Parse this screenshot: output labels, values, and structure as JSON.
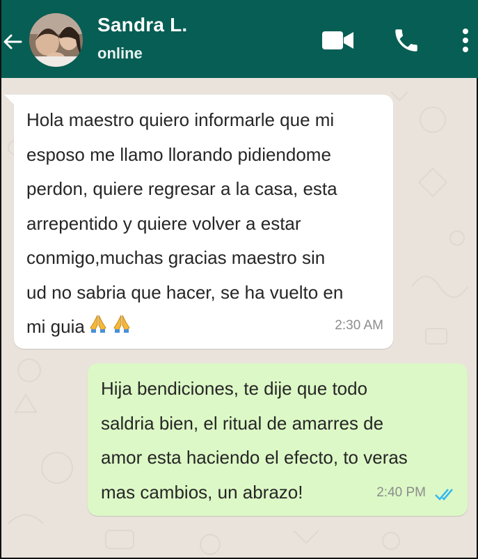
{
  "header": {
    "contact_name": "Sandra L.",
    "contact_status": "online",
    "icons": [
      "back-arrow-icon",
      "video-call-icon",
      "phone-icon",
      "more-options-icon"
    ]
  },
  "colors": {
    "header_bg": "#075e54",
    "chat_bg": "#e9e3dc",
    "incoming_bubble": "#ffffff",
    "outgoing_bubble": "#dcf8c6",
    "read_ticks": "#34b7f1"
  },
  "messages": [
    {
      "direction": "incoming",
      "text": "Hola maestro quiero informarle que mi\nesposo me llamo llorando pidiendome\nperdon, quiere regresar a la casa, esta\narrepentido y quiere volver a estar\nconmigo,muchas gracias maestro sin\nud no sabria que hacer, se ha vuelto en\nmi guia",
      "emoji": [
        "praying-hands-icon",
        "praying-hands-icon"
      ],
      "time": "2:30 AM"
    },
    {
      "direction": "outgoing",
      "text": "Hija bendiciones, te dije que todo\nsaldria bien, el ritual de amarres de\namor esta haciendo el efecto, to veras\nmas cambios, un abrazo!",
      "time": "2:40 PM",
      "read_status": "read"
    }
  ]
}
